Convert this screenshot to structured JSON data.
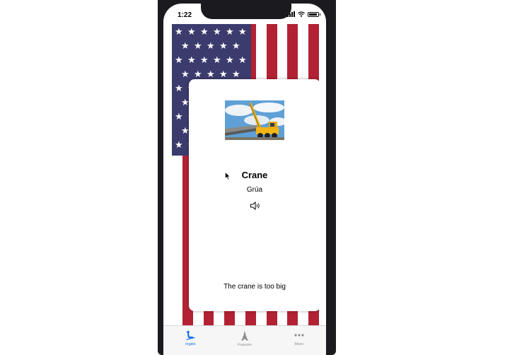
{
  "status_bar": {
    "time": "1:22"
  },
  "card": {
    "image_name": "crane-photo",
    "word": "Crane",
    "translation": "Grúa",
    "sentence": "The crane is too big"
  },
  "tabs": [
    {
      "label": "Inglés",
      "icon": "person-skiing-icon",
      "active": true
    },
    {
      "label": "Francés",
      "icon": "eiffel-tower-icon",
      "active": false
    },
    {
      "label": "More",
      "icon": "more-dots-icon",
      "active": false
    }
  ],
  "colors": {
    "flag_red": "#b22234",
    "flag_blue": "#3c3b6e",
    "tab_active": "#1a73e8",
    "tab_inactive": "#8e8e93"
  }
}
